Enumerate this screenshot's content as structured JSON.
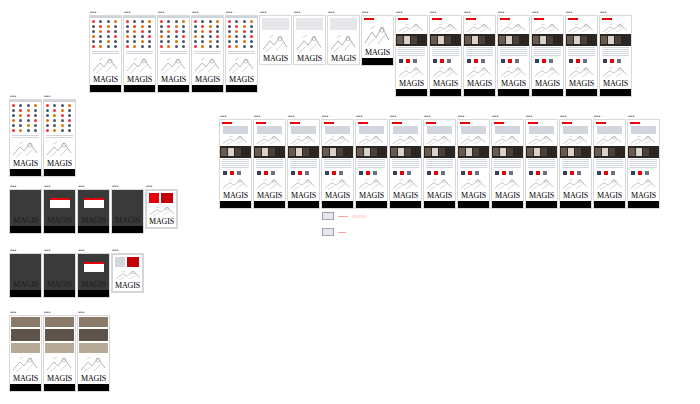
{
  "canvas": {
    "groups": [
      {
        "name": "top-row",
        "frames": [
          {
            "label": "•••",
            "kind": "grid",
            "logo": "MAGIS"
          },
          {
            "label": "•••",
            "kind": "grid",
            "logo": "MAGIS"
          },
          {
            "label": "•••",
            "kind": "grid",
            "logo": "MAGIS"
          },
          {
            "label": "•••",
            "kind": "grid",
            "logo": "MAGIS"
          },
          {
            "label": "•••",
            "kind": "grid",
            "logo": "MAGIS"
          },
          {
            "label": "•••",
            "kind": "sketch",
            "logo": "MAGIS"
          },
          {
            "label": "•••",
            "kind": "sketch",
            "logo": "MAGIS"
          },
          {
            "label": "•••",
            "kind": "sketch",
            "logo": "MAGIS"
          },
          {
            "label": "•••",
            "kind": "logo",
            "logo": "MAGIS"
          },
          {
            "label": "•••",
            "kind": "product",
            "logo": "MAGIS"
          },
          {
            "label": "•••",
            "kind": "product",
            "logo": "MAGIS"
          },
          {
            "label": "•••",
            "kind": "product",
            "logo": "MAGIS"
          },
          {
            "label": "•••",
            "kind": "product",
            "logo": "MAGIS"
          },
          {
            "label": "•••",
            "kind": "product",
            "logo": "MAGIS"
          },
          {
            "label": "•••",
            "kind": "product",
            "logo": "MAGIS"
          },
          {
            "label": "•••",
            "kind": "product",
            "logo": "MAGIS"
          }
        ]
      },
      {
        "name": "detail-row",
        "frames": [
          {
            "label": "•••",
            "kind": "detail",
            "logo": "MAGIS"
          },
          {
            "label": "•••",
            "kind": "detail",
            "logo": "MAGIS"
          },
          {
            "label": "•••",
            "kind": "detail",
            "logo": "MAGIS"
          },
          {
            "label": "•••",
            "kind": "detail",
            "logo": "MAGIS"
          },
          {
            "label": "•••",
            "kind": "detail",
            "logo": "MAGIS"
          },
          {
            "label": "•••",
            "kind": "detail",
            "logo": "MAGIS"
          },
          {
            "label": "•••",
            "kind": "detail",
            "logo": "MAGIS"
          },
          {
            "label": "•••",
            "kind": "detail",
            "logo": "MAGIS"
          },
          {
            "label": "•••",
            "kind": "detail",
            "logo": "MAGIS"
          },
          {
            "label": "•••",
            "kind": "detail",
            "logo": "MAGIS"
          },
          {
            "label": "•••",
            "kind": "detail",
            "logo": "MAGIS"
          },
          {
            "label": "•••",
            "kind": "detail",
            "logo": "MAGIS"
          },
          {
            "label": "•••",
            "kind": "detail",
            "logo": "MAGIS"
          }
        ]
      },
      {
        "name": "left-grid",
        "frames": [
          {
            "label": "•••",
            "kind": "grid",
            "logo": "MAGIS"
          },
          {
            "label": "•••",
            "kind": "grid",
            "logo": "MAGIS"
          }
        ]
      },
      {
        "name": "left-dark-1",
        "frames": [
          {
            "label": "•••",
            "kind": "dark",
            "logo": "MAGIS"
          },
          {
            "label": "•••",
            "kind": "dark-modal",
            "logo": "MAGIS"
          },
          {
            "label": "•••",
            "kind": "dark-modal",
            "logo": "MAGIS"
          },
          {
            "label": "•••",
            "kind": "dark",
            "logo": "MAGIS"
          },
          {
            "label": "•••",
            "kind": "red",
            "logo": "MAGIS"
          }
        ]
      },
      {
        "name": "left-dark-2",
        "frames": [
          {
            "label": "•••",
            "kind": "dark",
            "logo": "MAGIS"
          },
          {
            "label": "•••",
            "kind": "dark",
            "logo": "MAGIS"
          },
          {
            "label": "•••",
            "kind": "dark-modal",
            "logo": "MAGIS"
          },
          {
            "label": "•••",
            "kind": "white",
            "logo": "MAGIS"
          }
        ]
      },
      {
        "name": "left-photo",
        "frames": [
          {
            "label": "•••",
            "kind": "photo",
            "logo": "MAGIS"
          },
          {
            "label": "•••",
            "kind": "photo",
            "logo": "MAGIS"
          },
          {
            "label": "•••",
            "kind": "photo",
            "logo": "MAGIS"
          }
        ]
      }
    ]
  }
}
